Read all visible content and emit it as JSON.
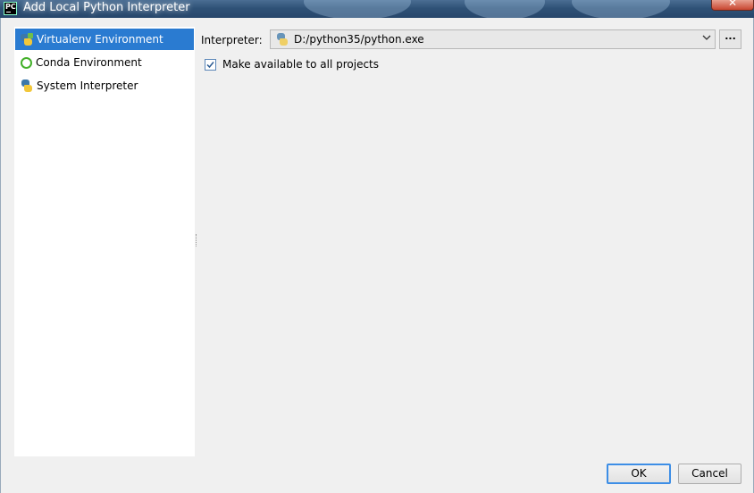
{
  "window": {
    "title": "Add Local Python Interpreter",
    "app_icon_text": "PC",
    "close_symbol": "✕"
  },
  "sidebar": {
    "items": [
      {
        "label": "Virtualenv Environment",
        "icon": "virtualenv-icon",
        "selected": true
      },
      {
        "label": "Conda Environment",
        "icon": "conda-icon",
        "selected": false
      },
      {
        "label": "System Interpreter",
        "icon": "python-icon",
        "selected": false
      }
    ]
  },
  "form": {
    "interpreter_label": "Interpreter:",
    "interpreter_value": "D:/python35/python.exe",
    "browse_label": "...",
    "make_available_label": "Make available to all projects",
    "make_available_checked": true
  },
  "buttons": {
    "ok_label": "OK",
    "cancel_label": "Cancel"
  },
  "colors": {
    "selection": "#2a7bd1",
    "title_bar": "#2f5277",
    "dialog_bg": "#f0f0f0"
  }
}
